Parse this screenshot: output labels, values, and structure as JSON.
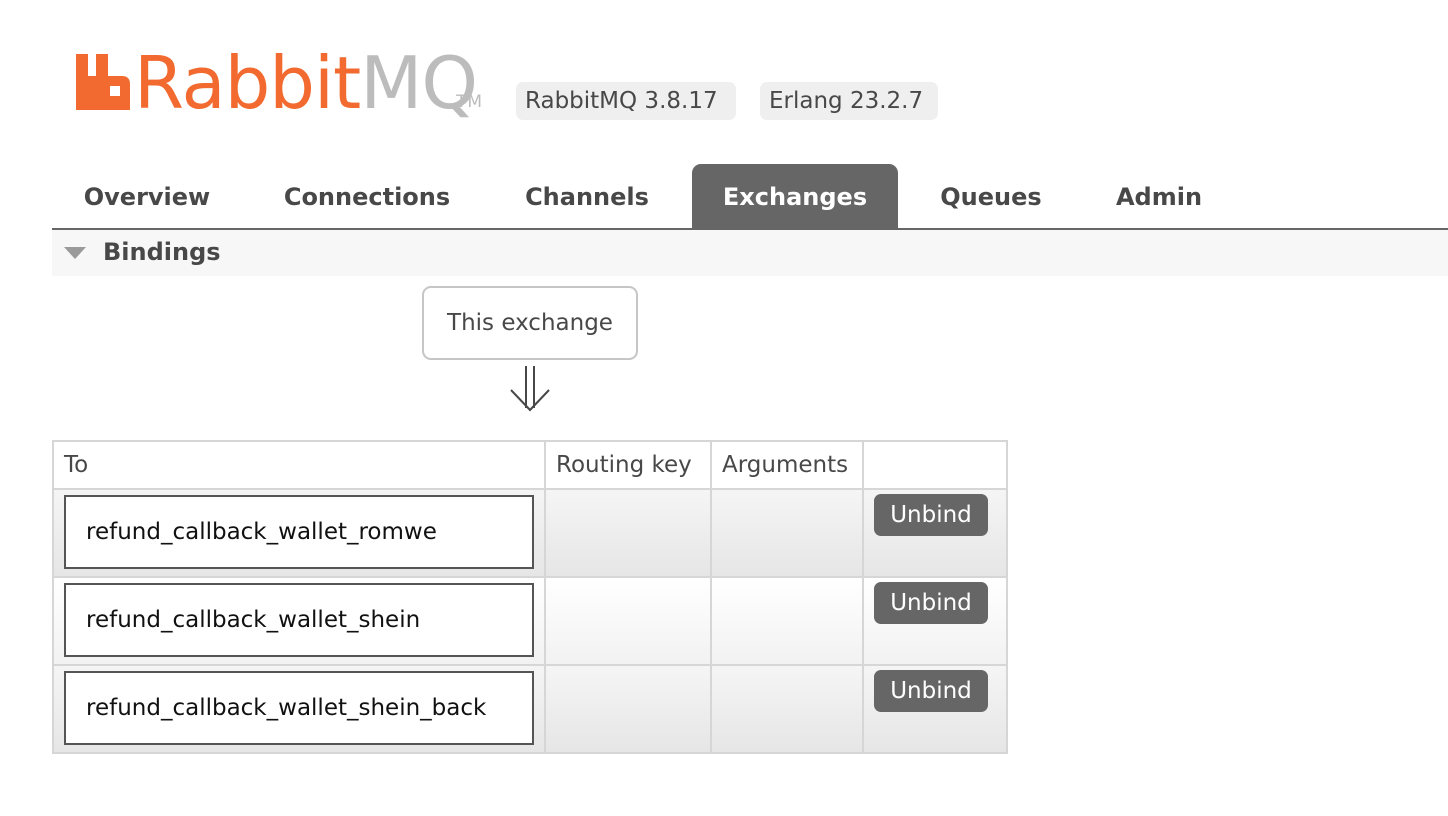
{
  "header": {
    "logo": {
      "brand": "Rabbit",
      "brand_suffix": "MQ",
      "trademark": "TM"
    },
    "rabbitmq_version": "RabbitMQ 3.8.17",
    "erlang_version": "Erlang 23.2.7"
  },
  "tabs": [
    {
      "label": "Overview",
      "active": false
    },
    {
      "label": "Connections",
      "active": false
    },
    {
      "label": "Channels",
      "active": false
    },
    {
      "label": "Exchanges",
      "active": true
    },
    {
      "label": "Queues",
      "active": false
    },
    {
      "label": "Admin",
      "active": false
    }
  ],
  "bindings": {
    "section_title": "Bindings",
    "source_label": "This exchange",
    "arrow_icon": "double-down-arrow-icon",
    "columns": {
      "to": "To",
      "routing_key": "Routing key",
      "arguments": "Arguments",
      "actions": ""
    },
    "rows": [
      {
        "to": "refund_callback_wallet_romwe",
        "routing_key": "",
        "arguments": "",
        "action": "Unbind"
      },
      {
        "to": "refund_callback_wallet_shein",
        "routing_key": "",
        "arguments": "",
        "action": "Unbind"
      },
      {
        "to": "refund_callback_wallet_shein_back",
        "routing_key": "",
        "arguments": "",
        "action": "Unbind"
      }
    ]
  },
  "colors": {
    "brand_orange": "#f26a2f",
    "brand_grey": "#bcbcbc",
    "active_tab": "#666666",
    "button": "#666666"
  }
}
